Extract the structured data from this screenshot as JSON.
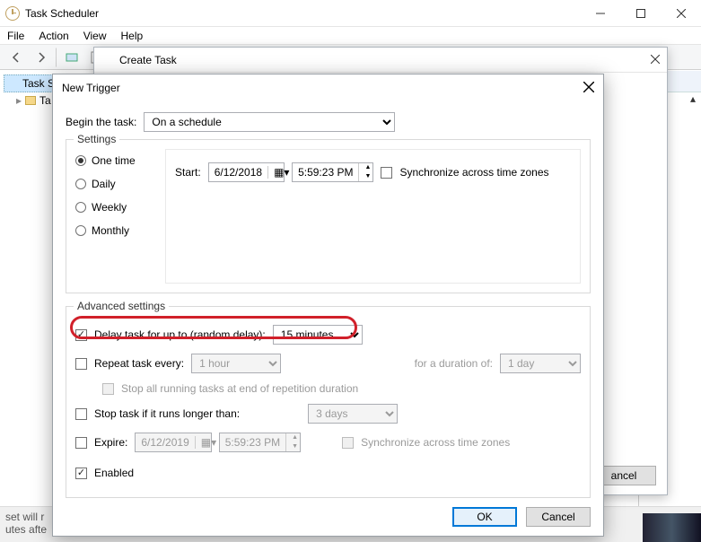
{
  "app": {
    "title": "Task Scheduler"
  },
  "menu": {
    "file": "File",
    "action": "Action",
    "view": "View",
    "help": "Help"
  },
  "tree": {
    "root": "Task S",
    "child": "Ta"
  },
  "create_task": {
    "title": "Create Task",
    "cancel": "ancel"
  },
  "dlg": {
    "title": "New Trigger",
    "begin_label": "Begin the task:",
    "begin_value": "On a schedule",
    "settings_legend": "Settings",
    "freq": {
      "one": "One time",
      "daily": "Daily",
      "weekly": "Weekly",
      "monthly": "Monthly"
    },
    "start_label": "Start:",
    "start_date": "6/12/2018",
    "start_time": "5:59:23 PM",
    "sync_tz": "Synchronize across time zones",
    "adv_legend": "Advanced settings",
    "delay_label": "Delay task for up to (random delay):",
    "delay_value": "15 minutes",
    "repeat_label": "Repeat task every:",
    "repeat_value": "1 hour",
    "duration_label": "for a duration of:",
    "duration_value": "1 day",
    "stop_all": "Stop all running tasks at end of repetition duration",
    "stop_if_label": "Stop task if it runs longer than:",
    "stop_if_value": "3 days",
    "expire_label": "Expire:",
    "expire_date": "6/12/2019",
    "expire_time": "5:59:23 PM",
    "expire_sync": "Synchronize across time zones",
    "enabled": "Enabled",
    "ok": "OK",
    "cancel": "Cancel"
  },
  "clip": {
    "line1": "set will r",
    "line2": "utes afte"
  }
}
